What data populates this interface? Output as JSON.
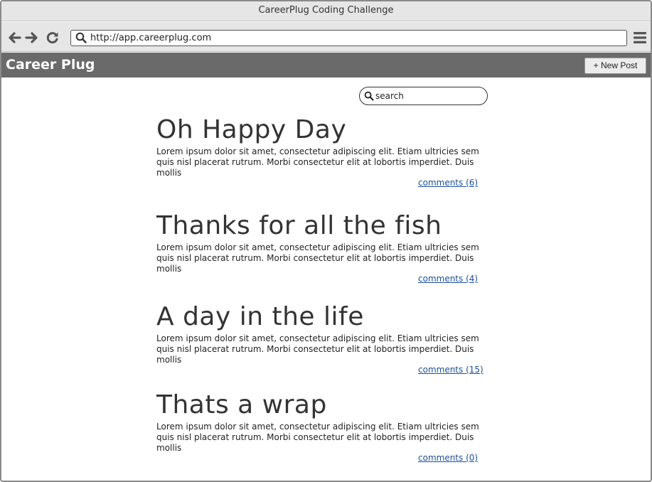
{
  "window": {
    "title": "CareerPlug Coding Challenge"
  },
  "browser": {
    "url": "http://app.careerplug.com",
    "icons": [
      "back-arrow-icon",
      "forward-arrow-icon",
      "reload-icon",
      "search-icon",
      "hamburger-menu-icon"
    ]
  },
  "header": {
    "brand": "Career Plug",
    "new_post_label": "+ New Post"
  },
  "search": {
    "placeholder": "search"
  },
  "posts": [
    {
      "title": "Oh Happy Day",
      "body": "Lorem ipsum dolor sit amet, consectetur adipiscing elit. Etiam ultricies sem quis nisl placerat rutrum. Morbi consectetur elit at lobortis imperdiet. Duis mollis",
      "comments": "comments (6)"
    },
    {
      "title": "Thanks for all the fish",
      "body": "Lorem ipsum dolor sit amet, consectetur adipiscing elit. Etiam ultricies sem quis nisl placerat rutrum. Morbi consectetur elit at lobortis imperdiet. Duis mollis",
      "comments": "comments (4)"
    },
    {
      "title": "A day in the life",
      "body": "Lorem ipsum dolor sit amet, consectetur adipiscing elit. Etiam ultricies sem quis nisl placerat rutrum. Morbi consectetur elit at lobortis imperdiet. Duis mollis",
      "comments": "comments (15)"
    },
    {
      "title": "Thats a wrap",
      "body": "Lorem ipsum dolor sit amet, consectetur adipiscing elit. Etiam ultricies sem quis nisl placerat rutrum. Morbi consectetur elit at lobortis imperdiet. Duis mollis",
      "comments": "comments (0)"
    }
  ],
  "colors": {
    "appbar": "#6a6a6a",
    "link": "#1a4e9c",
    "chrome": "#e6e6e6"
  }
}
